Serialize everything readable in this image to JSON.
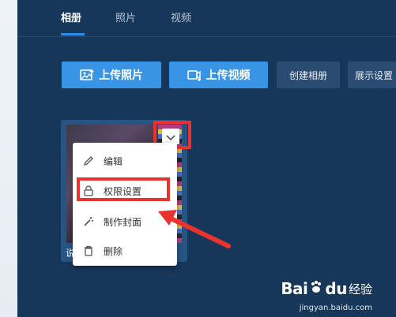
{
  "tabs": [
    {
      "label": "相册",
      "active": true
    },
    {
      "label": "照片",
      "active": false
    },
    {
      "label": "视频",
      "active": false
    }
  ],
  "toolbar": {
    "upload_photo": "上传照片",
    "upload_video": "上传视频",
    "create_album": "创建相册",
    "display_settings": "展示设置"
  },
  "album": {
    "label_fragment": "说"
  },
  "menu": {
    "items": [
      {
        "label": "编辑",
        "icon": "pencil-icon"
      },
      {
        "label": "权限设置",
        "icon": "lock-icon"
      },
      {
        "label": "制作封面",
        "icon": "wand-icon"
      },
      {
        "label": "删除",
        "icon": "trash-icon"
      }
    ]
  },
  "watermark": {
    "logo": "Bai",
    "logo_suffix": "du",
    "text": "经验",
    "url": "jingyan.baidu.com"
  },
  "colors": {
    "background": "#17375a",
    "accent": "#3a94e6",
    "highlight": "#e8332f"
  }
}
